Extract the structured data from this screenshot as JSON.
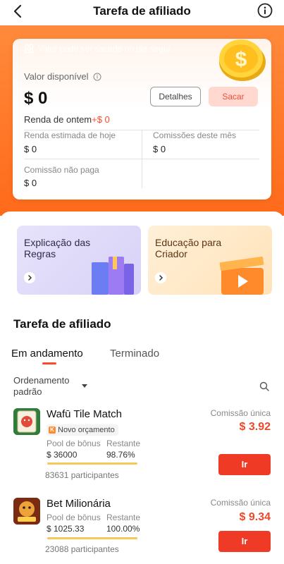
{
  "header": {
    "title": "Tarefa de afiliado",
    "back_icon": "chevron-left-icon",
    "info_icon": "info-circle-icon"
  },
  "summary": {
    "notice": "Valor pode ser sacado no dia segui...",
    "available_label": "Valor disponível",
    "available_value": "$ 0",
    "details_label": "Detalhes",
    "withdraw_label": "Sacar",
    "yesterday_label": "Renda de ontem",
    "yesterday_value": "+$ 0",
    "today_label": "Renda estimada de hoje",
    "today_value": "$ 0",
    "month_label": "Comissões deste mês",
    "month_value": "$ 0",
    "unpaid_label": "Comissão não paga",
    "unpaid_value": "$ 0"
  },
  "banners": [
    {
      "title": "Explicação das Regras"
    },
    {
      "title": "Educação para Criador"
    }
  ],
  "section": {
    "title": "Tarefa de afiliado",
    "tabs": [
      "Em andamento",
      "Terminado"
    ],
    "sort_label": "Ordenamento padrão"
  },
  "labels": {
    "pool": "Pool de bônus",
    "remaining": "Restante",
    "commission": "Comissão única",
    "go": "Ir"
  },
  "tasks": [
    {
      "name": "Wafū Tile Match",
      "badge": "Novo orçamento",
      "pool": "$ 36000",
      "remaining": "98.76%",
      "remaining_fraction": 0.9876,
      "participants": "83631 participantes",
      "commission": "$ 3.92"
    },
    {
      "name": "Bet Milionária",
      "pool": "$ 1025.33",
      "remaining": "100.00%",
      "remaining_fraction": 1.0,
      "participants": "23088 participantes",
      "commission": "$ 9.34"
    }
  ],
  "colors": {
    "accent": "#ef3b25",
    "hero": "#ff6a1a",
    "progress": "#f6c85a"
  }
}
